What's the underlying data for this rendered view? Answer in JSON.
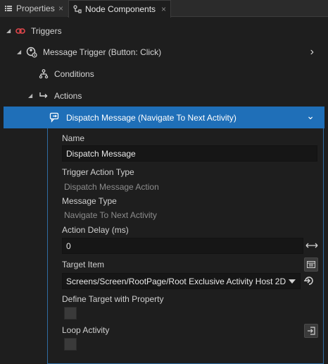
{
  "tabs": [
    {
      "label": "Properties",
      "close": "×"
    },
    {
      "label": "Node Components",
      "close": "×"
    }
  ],
  "tree": {
    "triggers": "Triggers",
    "message_trigger": "Message Trigger (Button: Click)",
    "conditions": "Conditions",
    "actions": "Actions",
    "dispatch": "Dispatch Message (Navigate To Next Activity)"
  },
  "props": {
    "name_label": "Name",
    "name_value": "Dispatch Message",
    "trigger_action_type_label": "Trigger Action Type",
    "trigger_action_type_value": "Dispatch Message Action",
    "message_type_label": "Message Type",
    "message_type_value": "Navigate To Next Activity",
    "action_delay_label": "Action Delay (ms)",
    "action_delay_value": "0",
    "target_item_label": "Target Item",
    "target_item_value": "Screens/Screen/RootPage/Root Exclusive Activity Host 2D",
    "define_target_label": "Define Target with Property",
    "define_target_checked": false,
    "loop_activity_label": "Loop Activity",
    "loop_activity_checked": false
  },
  "colors": {
    "selected_row": "#1f6fb8",
    "trigger_icon": "#e0474c",
    "background": "#1e1e1e"
  }
}
